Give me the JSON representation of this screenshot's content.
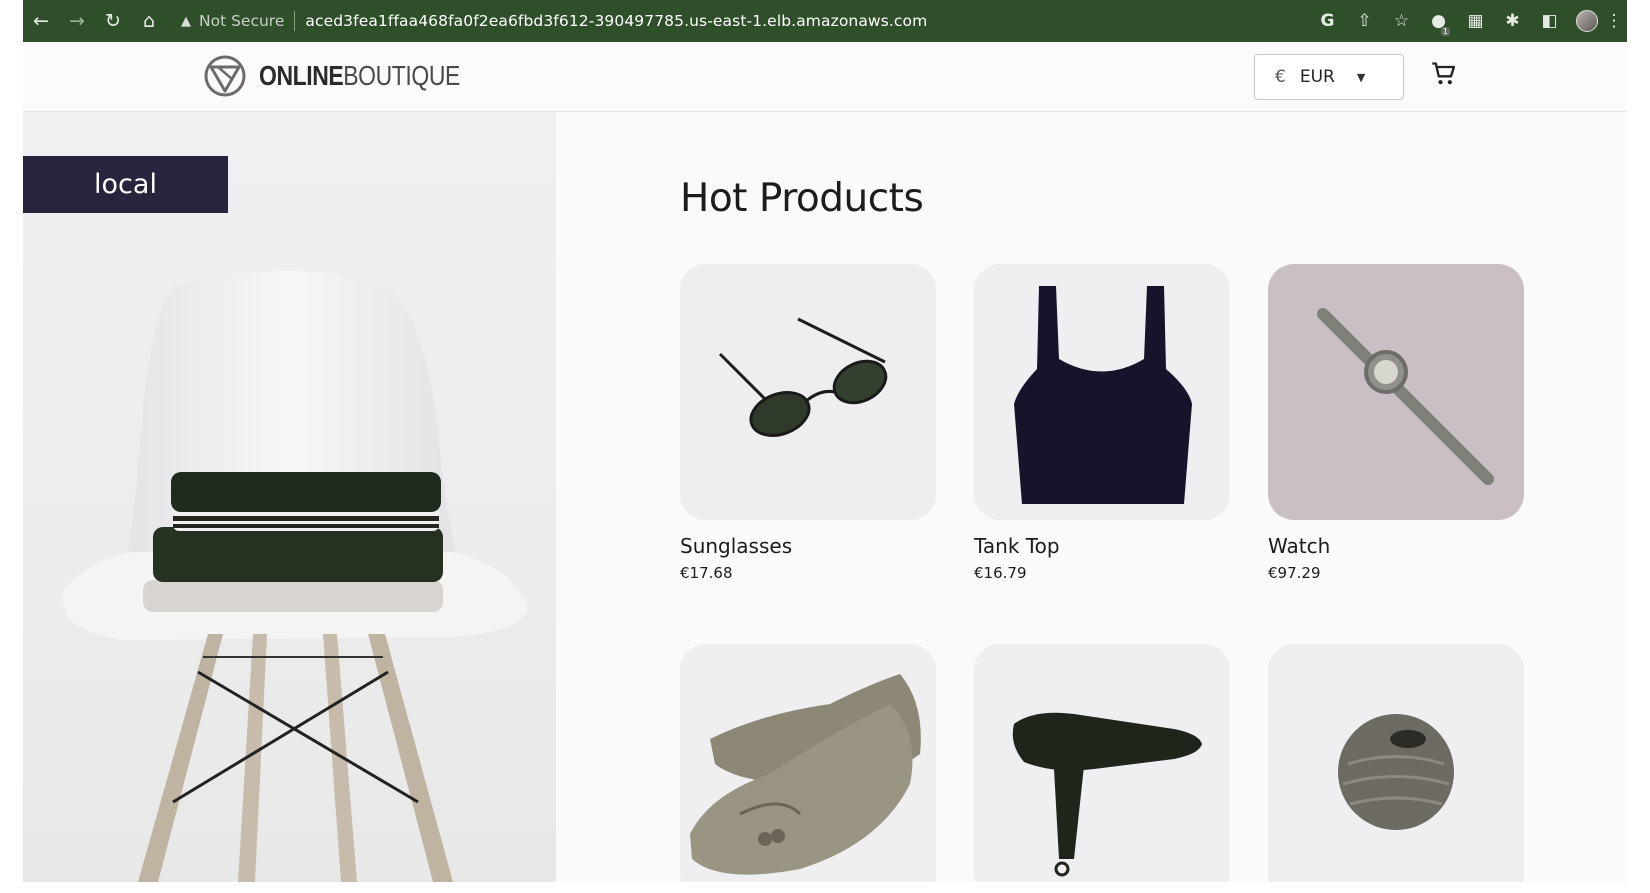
{
  "browser": {
    "warning_label": "Not Secure",
    "url": "aced3fea1ffaa468fa0f2ea6fbd3f612-390497785.us-east-1.elb.amazonaws.com",
    "extension_badge": "1"
  },
  "header": {
    "logo_bold": "ONLINE",
    "logo_light": "BOUTIQUE",
    "currency_symbol": "€",
    "currency_code": "EUR"
  },
  "hero": {
    "cluster_label": "local"
  },
  "main": {
    "section_title": "Hot Products",
    "products": [
      {
        "name": "Sunglasses",
        "price": "€17.68",
        "icon": "sunglasses"
      },
      {
        "name": "Tank Top",
        "price": "€16.79",
        "icon": "tank-top"
      },
      {
        "name": "Watch",
        "price": "€97.29",
        "icon": "watch"
      },
      {
        "name": "",
        "price": "",
        "icon": "loafers"
      },
      {
        "name": "",
        "price": "",
        "icon": "hairdryer"
      },
      {
        "name": "",
        "price": "",
        "icon": "candle-holder"
      }
    ]
  },
  "colors": {
    "browser_bar": "#2f4f2a",
    "cluster_badge": "#27253d",
    "text": "#1c1c1c"
  }
}
